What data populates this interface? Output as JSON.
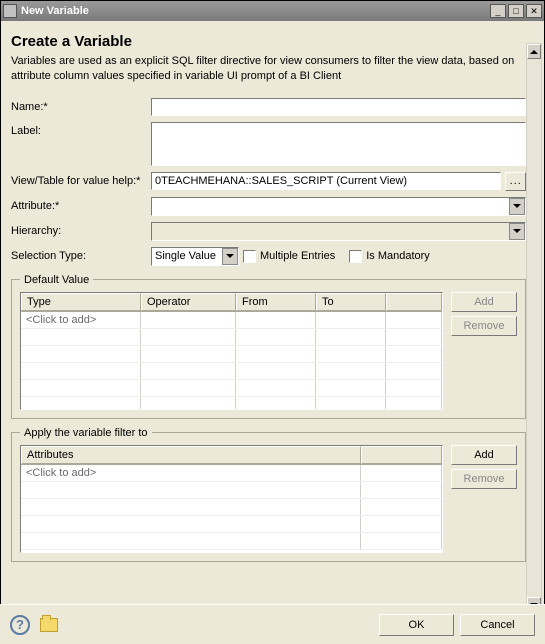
{
  "window": {
    "title": "New Variable"
  },
  "header": {
    "heading": "Create a Variable",
    "description": "Variables are used as an explicit SQL filter directive for view consumers to filter the view data, based on attribute column values specified in variable UI prompt of a BI Client"
  },
  "form": {
    "name_label": "Name:*",
    "name_value": "",
    "label_label": "Label:",
    "label_value": "",
    "viewtable_label": "View/Table for value help:*",
    "viewtable_value": "0TEACHMEHANA::SALES_SCRIPT (Current View)",
    "attribute_label": "Attribute:*",
    "attribute_value": "",
    "hierarchy_label": "Hierarchy:",
    "hierarchy_value": "",
    "selection_type_label": "Selection Type:",
    "selection_type_value": "Single Value",
    "multiple_entries_label": "Multiple Entries",
    "is_mandatory_label": "Is Mandatory"
  },
  "default_value": {
    "legend": "Default Value",
    "columns": [
      "Type",
      "Operator",
      "From",
      "To"
    ],
    "placeholder_row": "<Click to add>",
    "add_btn": "Add",
    "remove_btn": "Remove"
  },
  "apply_filter": {
    "legend": "Apply the variable filter to",
    "columns": [
      "Attributes"
    ],
    "placeholder_row": "<Click to add>",
    "add_btn": "Add",
    "remove_btn": "Remove"
  },
  "footer": {
    "ok": "OK",
    "cancel": "Cancel"
  }
}
